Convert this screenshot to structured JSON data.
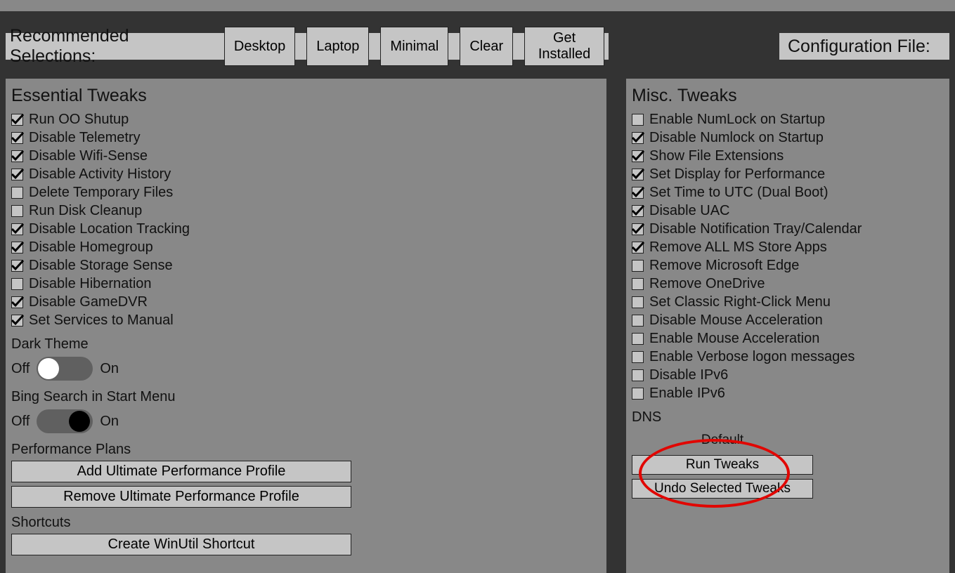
{
  "toolbar": {
    "title": "Recommended Selections:",
    "buttons": [
      "Desktop",
      "Laptop",
      "Minimal",
      "Clear",
      "Get Installed"
    ],
    "config_label": "Configuration File:"
  },
  "essential": {
    "title": "Essential Tweaks",
    "items": [
      {
        "label": "Run OO Shutup",
        "checked": true
      },
      {
        "label": "Disable Telemetry",
        "checked": true
      },
      {
        "label": "Disable Wifi-Sense",
        "checked": true
      },
      {
        "label": "Disable Activity History",
        "checked": true
      },
      {
        "label": "Delete Temporary Files",
        "checked": false
      },
      {
        "label": "Run Disk Cleanup",
        "checked": false
      },
      {
        "label": "Disable Location Tracking",
        "checked": true
      },
      {
        "label": "Disable Homegroup",
        "checked": true
      },
      {
        "label": "Disable Storage Sense",
        "checked": true
      },
      {
        "label": "Disable Hibernation",
        "checked": false
      },
      {
        "label": "Disable GameDVR",
        "checked": true
      },
      {
        "label": "Set Services to Manual",
        "checked": true
      }
    ],
    "dark_theme": {
      "title": "Dark Theme",
      "off": "Off",
      "on": "On",
      "state": "off"
    },
    "bing": {
      "title": "Bing Search in Start Menu",
      "off": "Off",
      "on": "On",
      "state": "on"
    },
    "perf_title": "Performance Plans",
    "perf_add": "Add Ultimate Performance Profile",
    "perf_remove": "Remove Ultimate Performance Profile",
    "shortcuts_title": "Shortcuts",
    "shortcut_btn": "Create WinUtil Shortcut"
  },
  "misc": {
    "title": "Misc. Tweaks",
    "items": [
      {
        "label": "Enable NumLock on Startup",
        "checked": false
      },
      {
        "label": "Disable Numlock on Startup",
        "checked": true
      },
      {
        "label": "Show File Extensions",
        "checked": true
      },
      {
        "label": "Set Display for Performance",
        "checked": true
      },
      {
        "label": "Set Time to UTC (Dual Boot)",
        "checked": true
      },
      {
        "label": "Disable UAC",
        "checked": true
      },
      {
        "label": "Disable Notification Tray/Calendar",
        "checked": true
      },
      {
        "label": "Remove ALL MS Store Apps",
        "checked": true
      },
      {
        "label": "Remove Microsoft Edge",
        "checked": false
      },
      {
        "label": "Remove OneDrive",
        "checked": false
      },
      {
        "label": "Set Classic Right-Click Menu",
        "checked": false
      },
      {
        "label": "Disable Mouse Acceleration",
        "checked": false
      },
      {
        "label": "Enable Mouse Acceleration",
        "checked": false
      },
      {
        "label": "Enable Verbose logon messages",
        "checked": false
      },
      {
        "label": "Disable IPv6",
        "checked": false
      },
      {
        "label": "Enable IPv6",
        "checked": false
      }
    ],
    "dns_title": "DNS",
    "dns_default": "Default",
    "run": "Run Tweaks",
    "undo": "Undo Selected Tweaks"
  }
}
